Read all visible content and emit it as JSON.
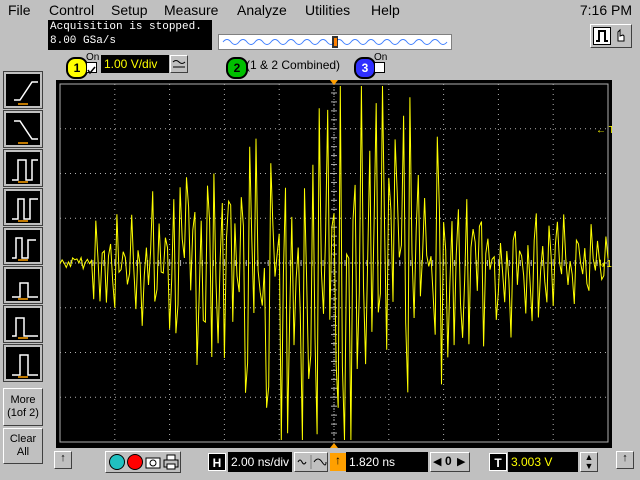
{
  "menu": {
    "items": [
      {
        "label": "File"
      },
      {
        "label": "Control"
      },
      {
        "label": "Setup"
      },
      {
        "label": "Measure"
      },
      {
        "label": "Analyze"
      },
      {
        "label": "Utilities"
      },
      {
        "label": "Help"
      }
    ],
    "clock": "7:16 PM"
  },
  "status": {
    "line1": "Acquisition is stopped.",
    "line2": "8.00 GSa/s"
  },
  "channels": {
    "ch1": {
      "number": "1",
      "on_label": "On",
      "scale": "1.00 V/div",
      "color": "#ffff00"
    },
    "ch2": {
      "number": "2",
      "label": "(1 & 2 Combined)",
      "color": "#00ff00"
    },
    "ch3": {
      "number": "3",
      "on_label": "On",
      "color": "#4040ff"
    }
  },
  "markers": {
    "trigger_label": "T",
    "ground_label": "1"
  },
  "sidebar": {
    "more_label": "More\n(1of 2)",
    "clear_label": "Clear\nAll",
    "tools": [
      "rising-edge-trigger-icon",
      "falling-edge-trigger-icon",
      "pulse-width-icon",
      "pulse-width-2-icon",
      "glitch-trigger-icon",
      "runt-trigger-icon",
      "timeout-trigger-icon",
      "pattern-trigger-icon"
    ]
  },
  "bottom": {
    "h_label": "H",
    "timebase": "2.00 ns/div",
    "delay": "1.820 ns",
    "t_label": "T",
    "trigger_level": "3.003 V",
    "nav_value": "0"
  },
  "colors": {
    "trace": "#ffff00",
    "grid": "#b0b0b0"
  }
}
